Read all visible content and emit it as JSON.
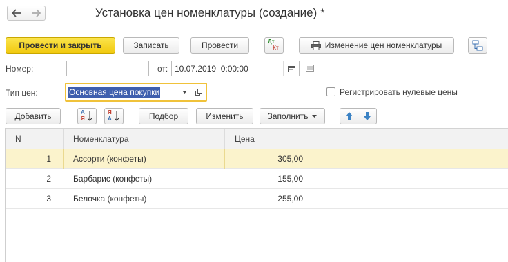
{
  "nav": {
    "back_icon": "arrow-left-icon",
    "forward_icon": "arrow-right-icon"
  },
  "window": {
    "title": "Установка цен номенклатуры (создание) *"
  },
  "toolbar": {
    "post_close": "Провести и закрыть",
    "save": "Записать",
    "post": "Провести",
    "dt_kt_top": "Дт",
    "dt_kt_bottom": "Кт",
    "print_change": "Изменение цен номенклатуры",
    "structure_icon": "structure-icon"
  },
  "form": {
    "number_label": "Номер:",
    "number_value": "",
    "date_label": "от:",
    "date_value": "10.07.2019  0:00:00",
    "price_type_label": "Тип цен:",
    "price_type_value": "Основная цена покупки",
    "register_zero_label": "Регистрировать нулевые цены",
    "register_zero_checked": false
  },
  "table_toolbar": {
    "add": "Добавить",
    "sort_asc_top": "А",
    "sort_asc_bottom": "Я",
    "sort_desc_top": "Я",
    "sort_desc_bottom": "А",
    "pick": "Подбор",
    "change": "Изменить",
    "fill": "Заполнить"
  },
  "table": {
    "columns": [
      "N",
      "Номенклатура",
      "Цена"
    ],
    "rows": [
      {
        "n": "1",
        "item": "Ассорти (конфеты)",
        "price": "305,00"
      },
      {
        "n": "2",
        "item": "Барбарис (конфеты)",
        "price": "155,00"
      },
      {
        "n": "3",
        "item": "Белочка (конфеты)",
        "price": "255,00"
      }
    ]
  },
  "colors": {
    "accent_yellow": "#f5d21f",
    "selected_row": "#fbf3cc",
    "focus_border": "#f0c23a",
    "selection_text_bg": "#3f5fae"
  }
}
